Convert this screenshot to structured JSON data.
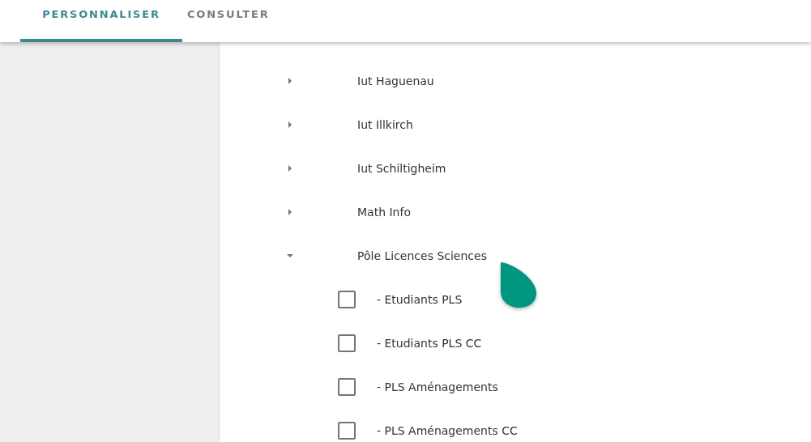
{
  "tabs": [
    {
      "label": "PERSONNALISER",
      "selected": true
    },
    {
      "label": "CONSULTER",
      "selected": false
    }
  ],
  "tree": {
    "items": [
      {
        "label": "Iut Haguenau",
        "expanded": false
      },
      {
        "label": "Iut Illkirch",
        "expanded": false
      },
      {
        "label": "Iut Schiltigheim",
        "expanded": false
      },
      {
        "label": "Math Info",
        "expanded": false
      },
      {
        "label": "Pôle Licences Sciences",
        "expanded": true,
        "children": [
          {
            "label": "- Etudiants PLS",
            "checked": false
          },
          {
            "label": "- Etudiants PLS CC",
            "checked": false
          },
          {
            "label": "- PLS Aménagements",
            "checked": false
          },
          {
            "label": "- PLS Aménagements CC",
            "checked": false
          }
        ]
      }
    ]
  }
}
